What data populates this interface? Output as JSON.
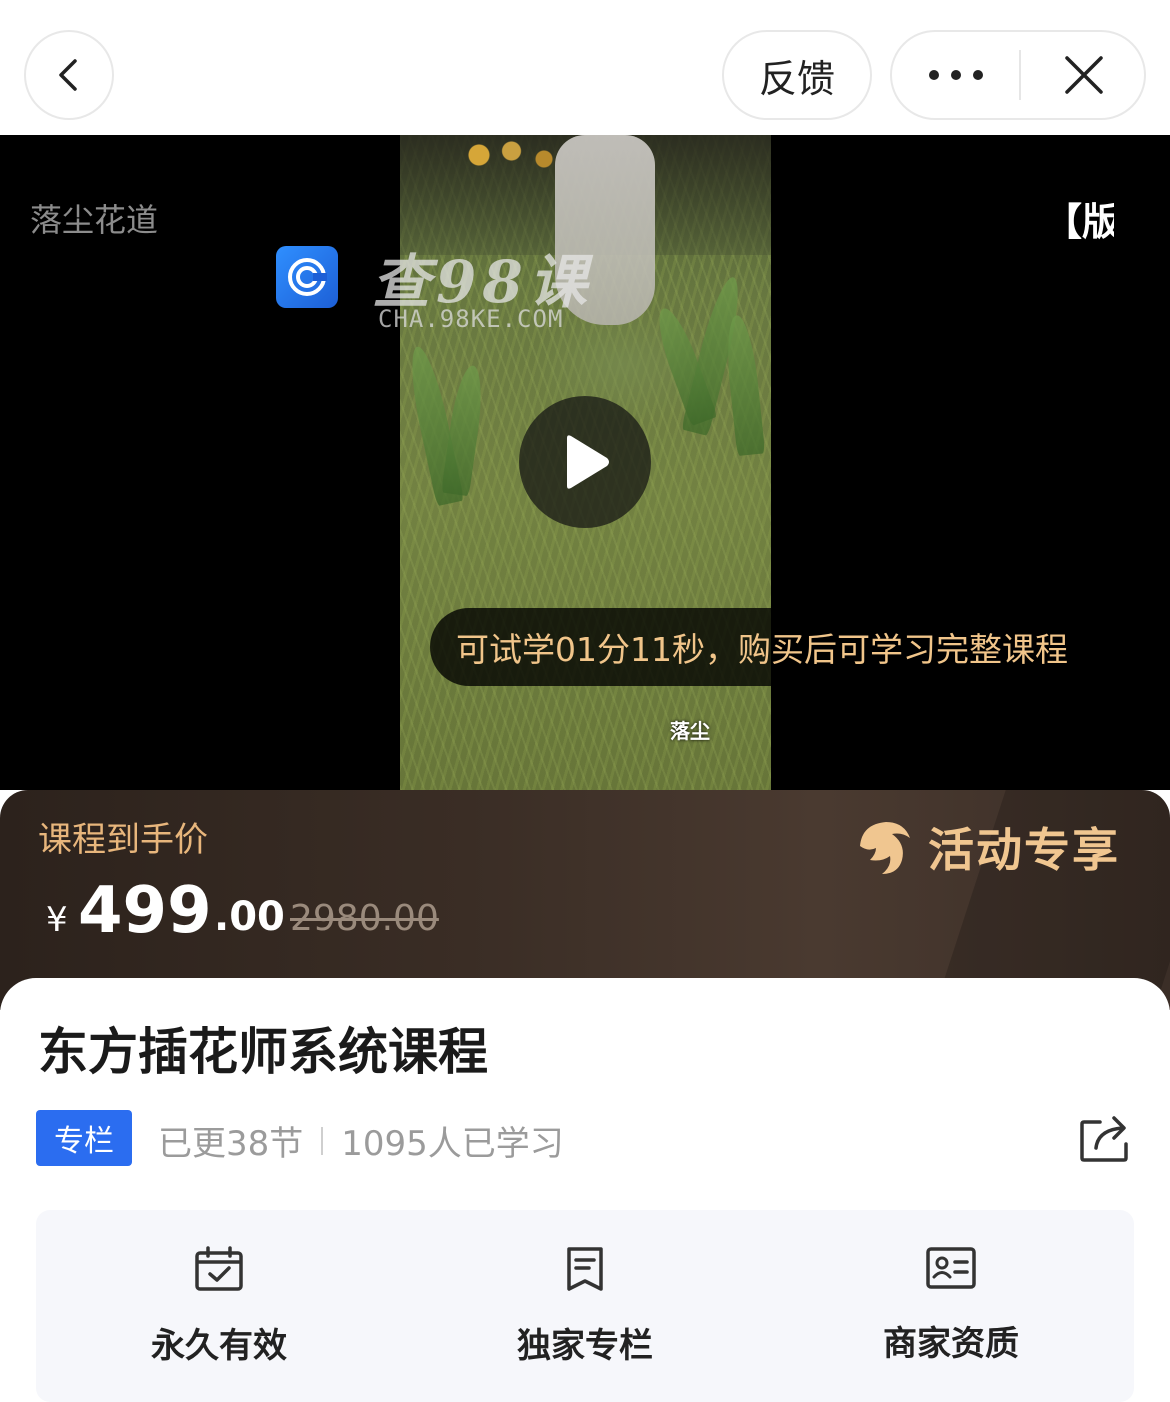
{
  "header": {
    "feedback_label": "反馈"
  },
  "video": {
    "channel_name": "落尘花道",
    "right_tag": "【版",
    "watermark_text": "查98课",
    "watermark_url": "CHA.98KE.COM",
    "trial_text": "可试学01分11秒，购买后可学习完整课程",
    "frame_caption": "落尘"
  },
  "price": {
    "label": "课程到手价",
    "currency": "¥",
    "integer": "499",
    "decimal": ".00",
    "original": "2980.00",
    "promo_text": "活动专享"
  },
  "course": {
    "title": "东方插花师系统课程",
    "tag": "专栏",
    "updated": "已更38节",
    "learners": "1095人已学习"
  },
  "features": [
    {
      "label": "永久有效",
      "icon": "calendar-check-icon"
    },
    {
      "label": "独家专栏",
      "icon": "bookmark-doc-icon"
    },
    {
      "label": "商家资质",
      "icon": "id-card-icon"
    }
  ],
  "colors": {
    "accent_blue": "#2b6df0",
    "price_gold": "#e8b67c",
    "trial_text": "#f1c58a"
  }
}
